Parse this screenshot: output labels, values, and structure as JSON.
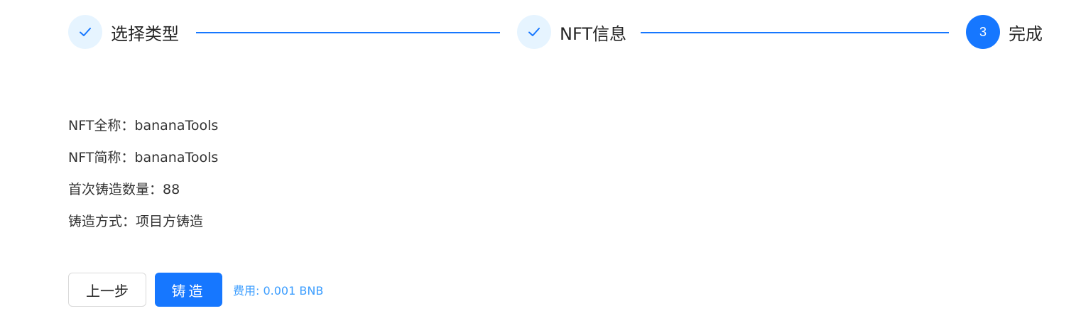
{
  "steps": [
    {
      "title": "选择类型",
      "status": "done",
      "icon": "check-icon"
    },
    {
      "title": "NFT信息",
      "status": "done",
      "icon": "check-icon"
    },
    {
      "title": "完成",
      "status": "active",
      "number": "3"
    }
  ],
  "info": {
    "full_name": "NFT全称：bananaTools",
    "short_name": "NFT简称：bananaTools",
    "initial_mint": "首次铸造数量：88",
    "mint_method": "铸造方式：项目方铸造"
  },
  "actions": {
    "prev_label": "上一步",
    "mint_label": "铸造",
    "fee_text": "费用: 0.001 BNB"
  },
  "colors": {
    "primary": "#1677ff",
    "done_circle_bg": "#e6f4ff",
    "fee_text": "#3b9dff"
  }
}
